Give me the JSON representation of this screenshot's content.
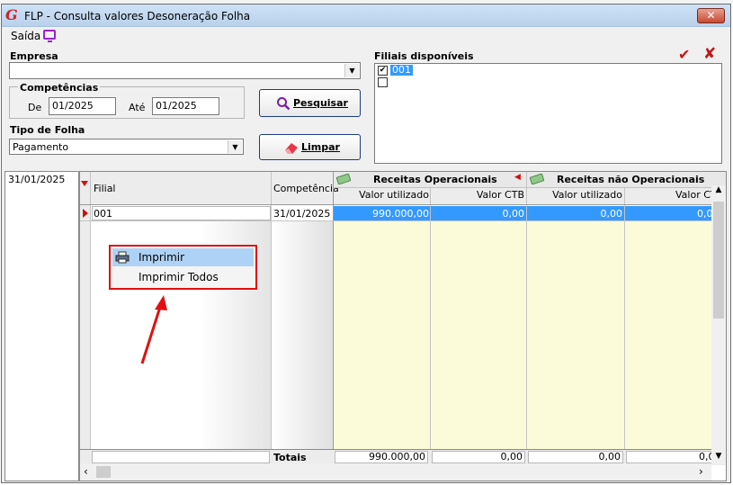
{
  "window": {
    "title": "FLP - Consulta valores Desoneração Folha",
    "close_label": "✕"
  },
  "menu": {
    "saida_label": "Saída",
    "monitor_icon": "monitor-icon"
  },
  "form": {
    "empresa_label": "Empresa",
    "empresa_value": "",
    "competencias_label": "Competências",
    "de_label": "De",
    "de_value": "01/2025",
    "ate_label": "Até",
    "ate_value": "01/2025",
    "tipo_folha_label": "Tipo de Folha",
    "tipo_folha_value": "Pagamento",
    "pesquisar_label": "Pesquisar",
    "limpar_label": "Limpar"
  },
  "filiais": {
    "label": "Filiais disponíveis",
    "confirm_icon": "check-icon",
    "cancel_icon": "close-icon",
    "items": [
      {
        "label": "001",
        "checked": true
      },
      {
        "label": "",
        "checked": false
      }
    ]
  },
  "dates": [
    "31/01/2025"
  ],
  "grid": {
    "columns": {
      "filial": "Filial",
      "competencia": "Competência",
      "group1": "Receitas Operacionais",
      "group2": "Receitas não Operacionais",
      "valor_utilizado": "Valor utilizado",
      "valor_ctb": "Valor CTB"
    },
    "rows": [
      {
        "filial": "001",
        "competencia": "31/01/2025",
        "ro_utilizado": "990.000,00",
        "ro_ctb": "0,00",
        "rno_utilizado": "0,00",
        "rno_ctb": "0,0"
      }
    ],
    "totals": {
      "label": "Totais",
      "ro_utilizado": "990.000,00",
      "ro_ctb": "0,00",
      "rno_utilizado": "0,00",
      "rno_ctb": "0,0"
    }
  },
  "context_menu": {
    "items": [
      {
        "label": "Imprimir",
        "icon": "printer-icon"
      },
      {
        "label": "Imprimir Todos"
      }
    ]
  },
  "colors": {
    "selection": "#3399ff",
    "highlight_red": "#e01010",
    "yellow_cells": "#fbfbd9"
  }
}
